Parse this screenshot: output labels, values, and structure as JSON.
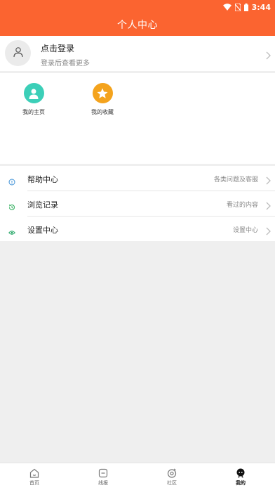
{
  "status_bar": {
    "time": "3:44",
    "icons": [
      "wifi-icon",
      "no-sim-icon",
      "battery-icon"
    ]
  },
  "header": {
    "title": "个人中心",
    "background": "#fb6430"
  },
  "login": {
    "title": "点击登录",
    "subtitle": "登录后查看更多",
    "avatar_icon": "user-icon"
  },
  "shortcuts": [
    {
      "label": "我的主页",
      "icon": "person-icon",
      "color": "#3ccfb8"
    },
    {
      "label": "我的收藏",
      "icon": "star-icon",
      "color": "#f4a31d"
    }
  ],
  "menu": [
    {
      "label": "帮助中心",
      "right_text": "各类问题及客服",
      "icon": "question-icon",
      "icon_color": "#3b8fd6"
    },
    {
      "label": "浏览记录",
      "right_text": "看过的内容",
      "icon": "history-icon",
      "icon_color": "#1fa84f"
    },
    {
      "label": "设置中心",
      "right_text": "设置中心",
      "icon": "settings-icon",
      "icon_color": "#2aa86a"
    }
  ],
  "tabs": [
    {
      "label": "首页",
      "icon": "home-icon",
      "active": false
    },
    {
      "label": "线报",
      "icon": "news-icon",
      "active": false
    },
    {
      "label": "社区",
      "icon": "community-icon",
      "active": false
    },
    {
      "label": "我的",
      "icon": "profile-icon",
      "active": true
    }
  ]
}
